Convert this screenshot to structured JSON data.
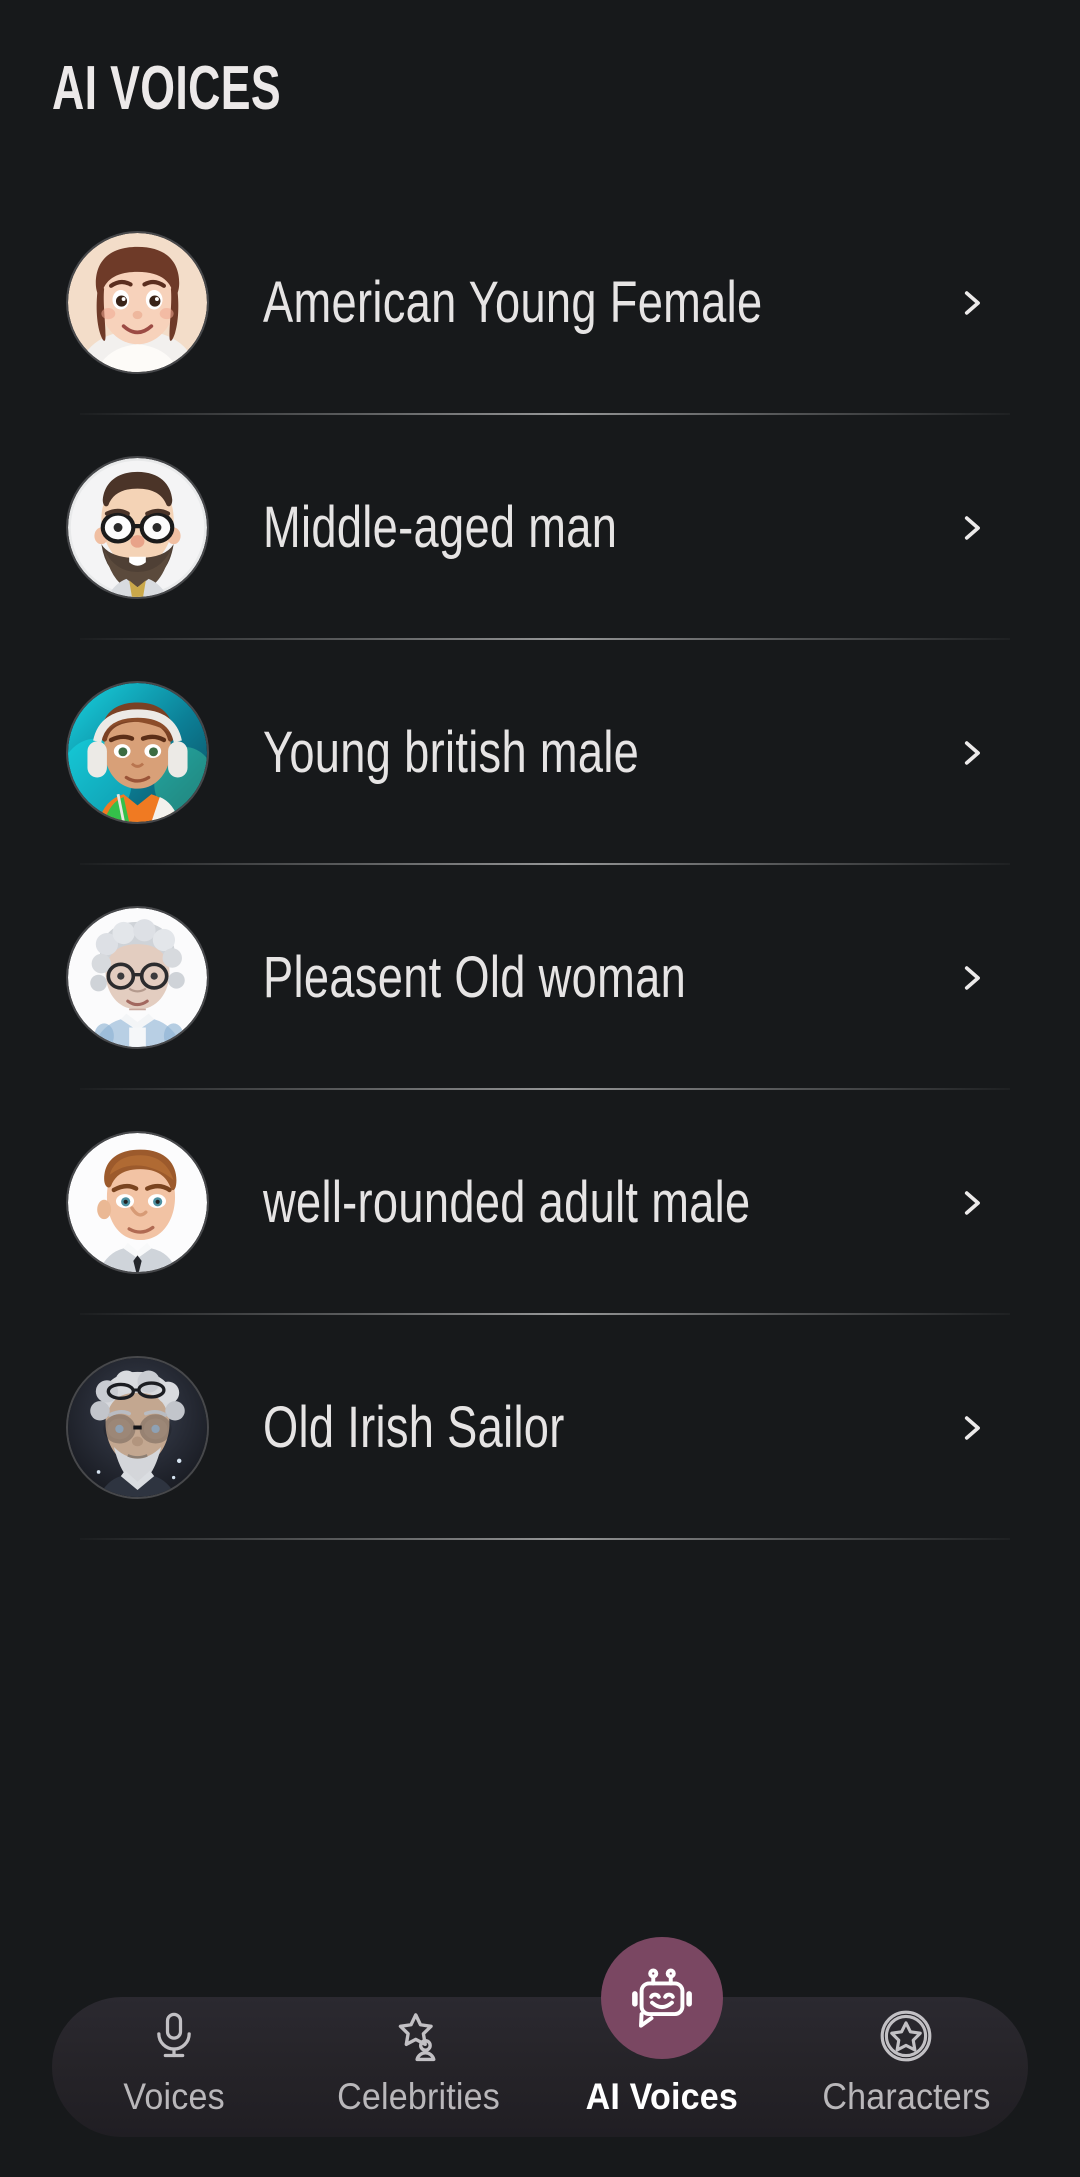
{
  "header": {
    "title": "AI VOICES"
  },
  "colors": {
    "background": "#17191b",
    "text_primary": "#e6e4e4",
    "text_muted": "#b9b7ba",
    "accent_purple": "#7a4762",
    "nav_pill": "#262429"
  },
  "voice_list": {
    "items": [
      {
        "name": "American Young Female",
        "avatar": "american-young-female-avatar",
        "chevron": "chevron-right-icon"
      },
      {
        "name": "Middle-aged man",
        "avatar": "middle-aged-man-avatar",
        "chevron": "chevron-right-icon"
      },
      {
        "name": "Young british male",
        "avatar": "young-british-male-avatar",
        "chevron": "chevron-right-icon"
      },
      {
        "name": "Pleasent Old woman",
        "avatar": "pleasent-old-woman-avatar",
        "chevron": "chevron-right-icon"
      },
      {
        "name": "well-rounded adult male",
        "avatar": "well-rounded-adult-male-avatar",
        "chevron": "chevron-right-icon"
      },
      {
        "name": "Old Irish Sailor",
        "avatar": "old-irish-sailor-avatar",
        "chevron": "chevron-right-icon"
      }
    ]
  },
  "bottom_nav": {
    "items": [
      {
        "label": "Voices",
        "icon": "microphone-icon",
        "active": false
      },
      {
        "label": "Celebrities",
        "icon": "star-person-icon",
        "active": false
      },
      {
        "label": "AI Voices",
        "icon": "robot-icon",
        "active": true
      },
      {
        "label": "Characters",
        "icon": "star-circle-icon",
        "active": false
      }
    ]
  }
}
